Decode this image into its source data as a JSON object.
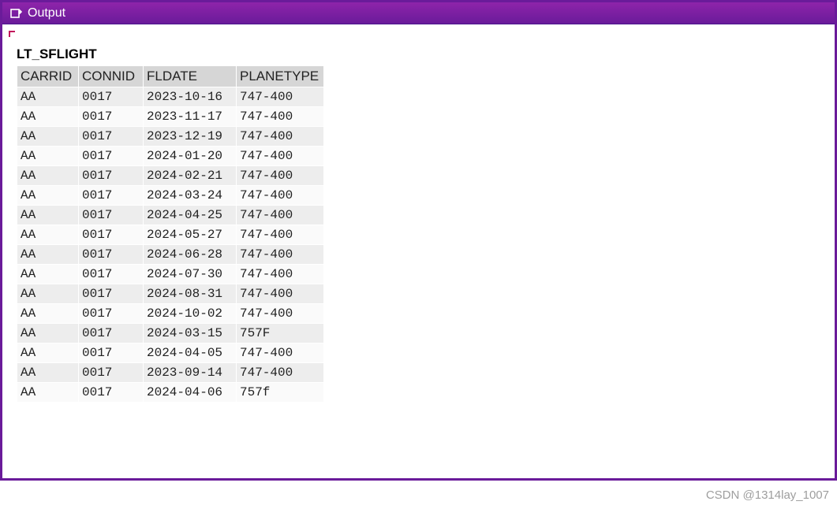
{
  "window": {
    "title": "Output"
  },
  "section": {
    "title": "LT_SFLIGHT"
  },
  "table": {
    "columns": [
      "CARRID",
      "CONNID",
      "FLDATE",
      "PLANETYPE"
    ],
    "rows": [
      {
        "carrid": "AA",
        "connid": "0017",
        "fldate": "2023-10-16",
        "planetype": "747-400"
      },
      {
        "carrid": "AA",
        "connid": "0017",
        "fldate": "2023-11-17",
        "planetype": "747-400"
      },
      {
        "carrid": "AA",
        "connid": "0017",
        "fldate": "2023-12-19",
        "planetype": "747-400"
      },
      {
        "carrid": "AA",
        "connid": "0017",
        "fldate": "2024-01-20",
        "planetype": "747-400"
      },
      {
        "carrid": "AA",
        "connid": "0017",
        "fldate": "2024-02-21",
        "planetype": "747-400"
      },
      {
        "carrid": "AA",
        "connid": "0017",
        "fldate": "2024-03-24",
        "planetype": "747-400"
      },
      {
        "carrid": "AA",
        "connid": "0017",
        "fldate": "2024-04-25",
        "planetype": "747-400"
      },
      {
        "carrid": "AA",
        "connid": "0017",
        "fldate": "2024-05-27",
        "planetype": "747-400"
      },
      {
        "carrid": "AA",
        "connid": "0017",
        "fldate": "2024-06-28",
        "planetype": "747-400"
      },
      {
        "carrid": "AA",
        "connid": "0017",
        "fldate": "2024-07-30",
        "planetype": "747-400"
      },
      {
        "carrid": "AA",
        "connid": "0017",
        "fldate": "2024-08-31",
        "planetype": "747-400"
      },
      {
        "carrid": "AA",
        "connid": "0017",
        "fldate": "2024-10-02",
        "planetype": "747-400"
      },
      {
        "carrid": "AA",
        "connid": "0017",
        "fldate": "2024-03-15",
        "planetype": "757F"
      },
      {
        "carrid": "AA",
        "connid": "0017",
        "fldate": "2024-04-05",
        "planetype": "747-400"
      },
      {
        "carrid": "AA",
        "connid": "0017",
        "fldate": "2023-09-14",
        "planetype": "747-400"
      },
      {
        "carrid": "AA",
        "connid": "0017",
        "fldate": "2024-04-06",
        "planetype": "757f"
      }
    ]
  },
  "footer": {
    "credit": "CSDN @1314lay_1007"
  }
}
